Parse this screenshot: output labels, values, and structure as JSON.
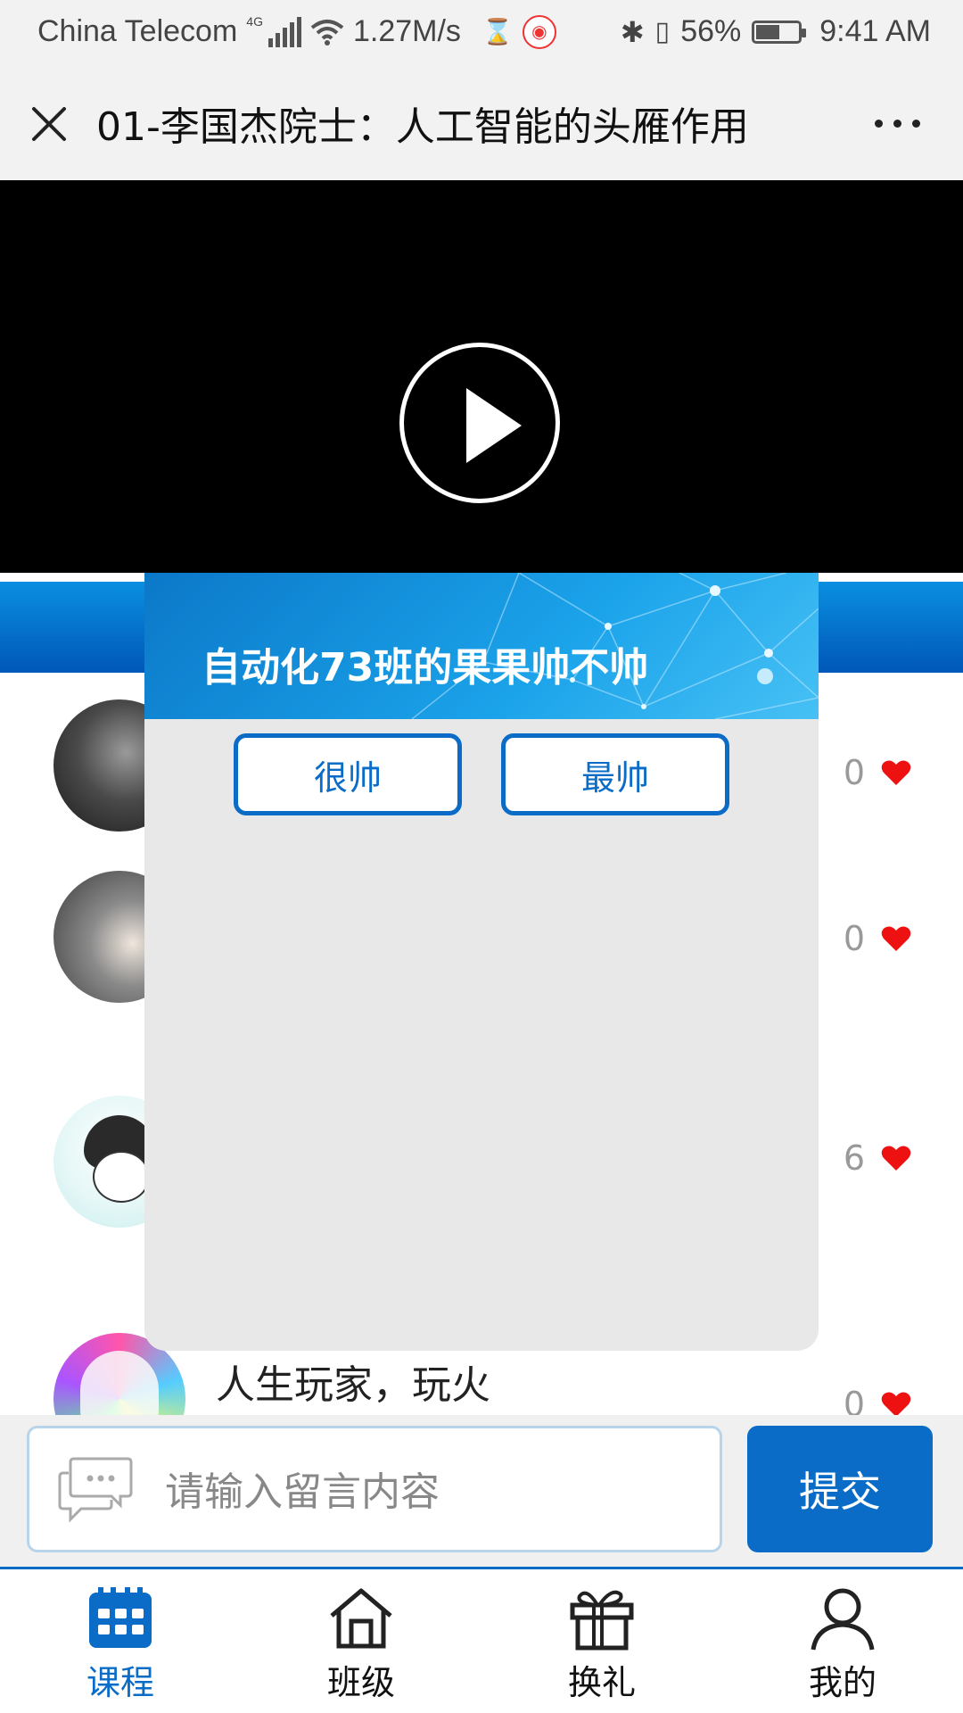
{
  "status_bar": {
    "carrier": "China Telecom",
    "network": "4G",
    "speed": "1.27M/s",
    "battery_percent": "56%",
    "battery_level": 0.56,
    "time": "9:41 AM"
  },
  "title_bar": {
    "title": "01-李国杰院士：人工智能的头雁作用"
  },
  "poll": {
    "question": "自动化73班的果果帅不帅",
    "options": [
      "很帅",
      "最帅"
    ]
  },
  "comments": [
    {
      "text": "",
      "likes": "0"
    },
    {
      "text": "",
      "likes": "0"
    },
    {
      "text": "",
      "likes": "6"
    },
    {
      "text": "人生玩家，玩火",
      "likes": "0"
    }
  ],
  "input": {
    "placeholder": "请输入留言内容",
    "submit_label": "提交"
  },
  "bottom_nav": [
    {
      "label": "课程",
      "icon": "calendar-icon",
      "active": true
    },
    {
      "label": "班级",
      "icon": "home-icon",
      "active": false
    },
    {
      "label": "换礼",
      "icon": "gift-icon",
      "active": false
    },
    {
      "label": "我的",
      "icon": "user-icon",
      "active": false
    }
  ],
  "colors": {
    "accent": "#0a6cc7",
    "like": "#ee1111"
  }
}
